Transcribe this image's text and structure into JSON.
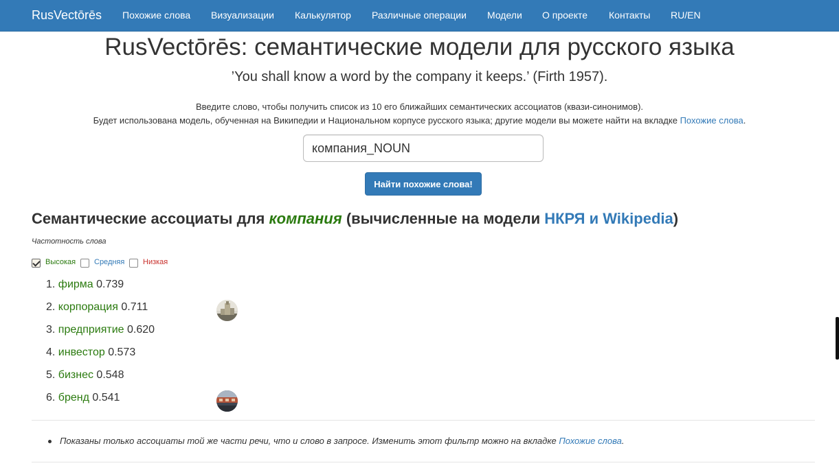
{
  "navbar": {
    "brand": "RusVectōrēs",
    "items": [
      {
        "label": "Похожие слова"
      },
      {
        "label": "Визуализации"
      },
      {
        "label": "Калькулятор"
      },
      {
        "label": "Различные операции"
      },
      {
        "label": "Модели"
      },
      {
        "label": "О проекте"
      },
      {
        "label": "Контакты"
      },
      {
        "label": "RU/EN"
      }
    ]
  },
  "header": {
    "title": "RusVectōrēs: семантические модели для русского языка",
    "quote": "’You shall know a word by the company it keeps.’ (Firth 1957)."
  },
  "intro": {
    "line1": "Введите слово, чтобы получить список из 10 его ближайших семантических ассоциатов (квази-синонимов).",
    "line2_text": "Будет использована модель, обученная на Википедии и Национальном корпусе русского языка; другие модели вы можете найти на вкладке",
    "line2_link": "Похожие слова",
    "line2_end": "."
  },
  "search": {
    "value": "компания_NOUN",
    "button_label": "Найти похожие слова!"
  },
  "results": {
    "heading_prefix": "Семантические ассоциаты для",
    "query_word": "компания",
    "heading_middle": "(вычисленные на модели",
    "model_name": "НКРЯ и Wikipedia",
    "heading_suffix": ")",
    "frequency_label": "Частотность слова",
    "frequency_filters": [
      {
        "label": "Высокая",
        "checked": true
      },
      {
        "label": "Средняя",
        "checked": false
      },
      {
        "label": "Низкая",
        "checked": false
      }
    ],
    "items": [
      {
        "num": "1.",
        "word": "фирма",
        "score": "0.739"
      },
      {
        "num": "2.",
        "word": "корпорация",
        "score": "0.711"
      },
      {
        "num": "3.",
        "word": "предприятие",
        "score": "0.620"
      },
      {
        "num": "4.",
        "word": "инвестор",
        "score": "0.573"
      },
      {
        "num": "5.",
        "word": "бизнес",
        "score": "0.548"
      },
      {
        "num": "6.",
        "word": "бренд",
        "score": "0.541"
      }
    ]
  },
  "note": {
    "text": "Показаны только ассоциаты той же части речи, что и слово в запросе. Изменить этот фильтр можно на вкладке",
    "link": "Похожие слова",
    "end": "."
  },
  "colors": {
    "navbar": "#337ab7",
    "word_green": "#2a7a0e",
    "link_blue": "#337ab7",
    "low_red": "#c9302c"
  }
}
